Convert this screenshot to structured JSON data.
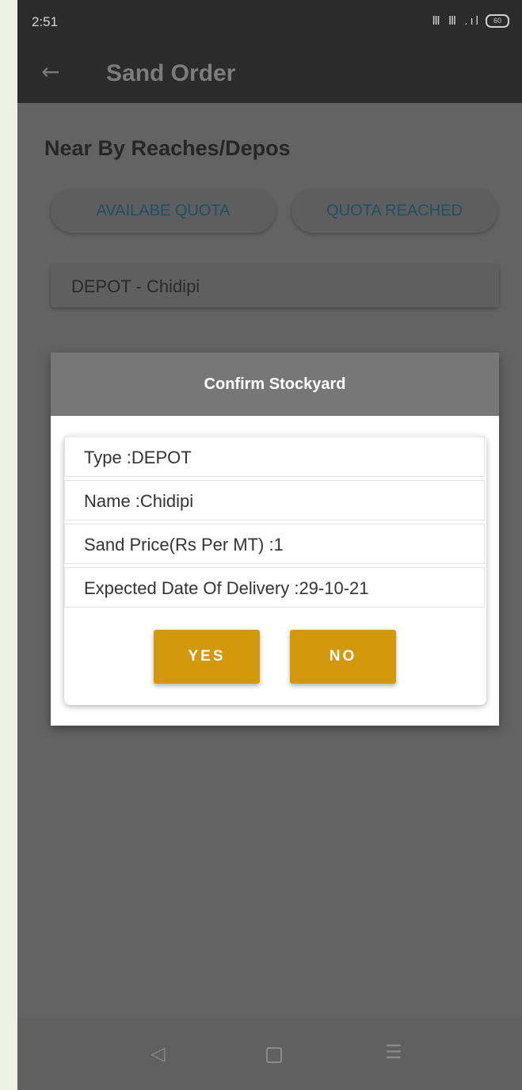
{
  "status_bar": {
    "time": "2:51",
    "signal_text": "Ⅲ Ⅲ .ıl",
    "battery": "60"
  },
  "app_bar": {
    "back_icon": "←",
    "title": "Sand Order"
  },
  "main": {
    "section_title": "Near By Reaches/Depos",
    "chips": {
      "available": "AVAILABE QUOTA",
      "reached": "QUOTA REACHED"
    },
    "depot_item": "DEPOT  -  Chidipi"
  },
  "dialog": {
    "title": "Confirm Stockyard",
    "rows": [
      "Type :DEPOT",
      "Name :Chidipi",
      "Sand Price(Rs Per MT) :1",
      "Expected Date Of Delivery :29-10-21"
    ],
    "yes_label": "YES",
    "no_label": "NO"
  },
  "nav_bar": {
    "back_icon": "◁",
    "menu_icon": "☰"
  },
  "colors": {
    "accent": "#d4980e",
    "appbar": "#2b2b2b",
    "chip_text": "#1f4f66"
  }
}
